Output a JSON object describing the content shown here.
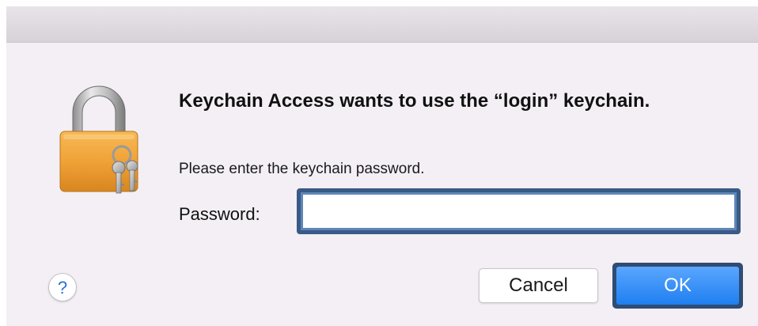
{
  "dialog": {
    "title": "Keychain Access wants to use the “login” keychain.",
    "message": "Please enter the keychain password.",
    "password_label": "Password:",
    "password_value": "",
    "password_placeholder": "",
    "help_label": "?",
    "cancel_label": "Cancel",
    "ok_label": "OK"
  },
  "icons": {
    "main": "keychain-lock-icon",
    "help": "help-icon"
  },
  "colors": {
    "dialog_bg": "#f3eff5",
    "focus_ring": "#3a5a86",
    "ok_button": "#1f7ff0",
    "help_glyph": "#2b6fd6"
  }
}
